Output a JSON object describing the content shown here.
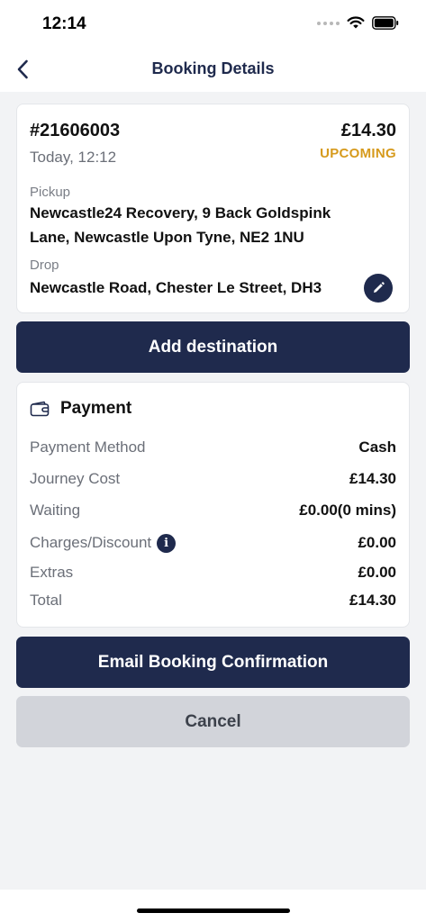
{
  "status_bar": {
    "time": "12:14"
  },
  "nav": {
    "title": "Booking Details"
  },
  "booking": {
    "id": "#21606003",
    "price": "£14.30",
    "time": "Today, 12:12",
    "status": "UPCOMING",
    "pickup_label": "Pickup",
    "pickup_line1": "Newcastle24 Recovery, 9 Back Goldspink",
    "pickup_line2": "Lane, Newcastle Upon Tyne, NE2 1NU",
    "drop_label": "Drop",
    "drop_address": "Newcastle Road, Chester Le Street, DH3"
  },
  "actions": {
    "add_destination": "Add destination",
    "email_confirmation": "Email Booking Confirmation",
    "cancel": "Cancel"
  },
  "payment": {
    "title": "Payment",
    "rows": [
      {
        "label": "Payment Method",
        "value": "Cash"
      },
      {
        "label": "Journey Cost",
        "value": "£14.30"
      },
      {
        "label": "Waiting",
        "value": "£0.00(0 mins)"
      },
      {
        "label": "Charges/Discount",
        "value": "£0.00"
      },
      {
        "label": "Extras",
        "value": "£0.00"
      },
      {
        "label": "Total",
        "value": "£14.30"
      }
    ]
  },
  "colors": {
    "primary": "#1f2a4d",
    "status_upcoming": "#d69a1c",
    "background": "#f2f3f5",
    "secondary_button": "#d2d4da"
  },
  "icons": [
    "signal-dots-icon",
    "wifi-icon",
    "battery-icon",
    "back-chevron-icon",
    "pencil-icon",
    "wallet-icon",
    "info-icon"
  ]
}
